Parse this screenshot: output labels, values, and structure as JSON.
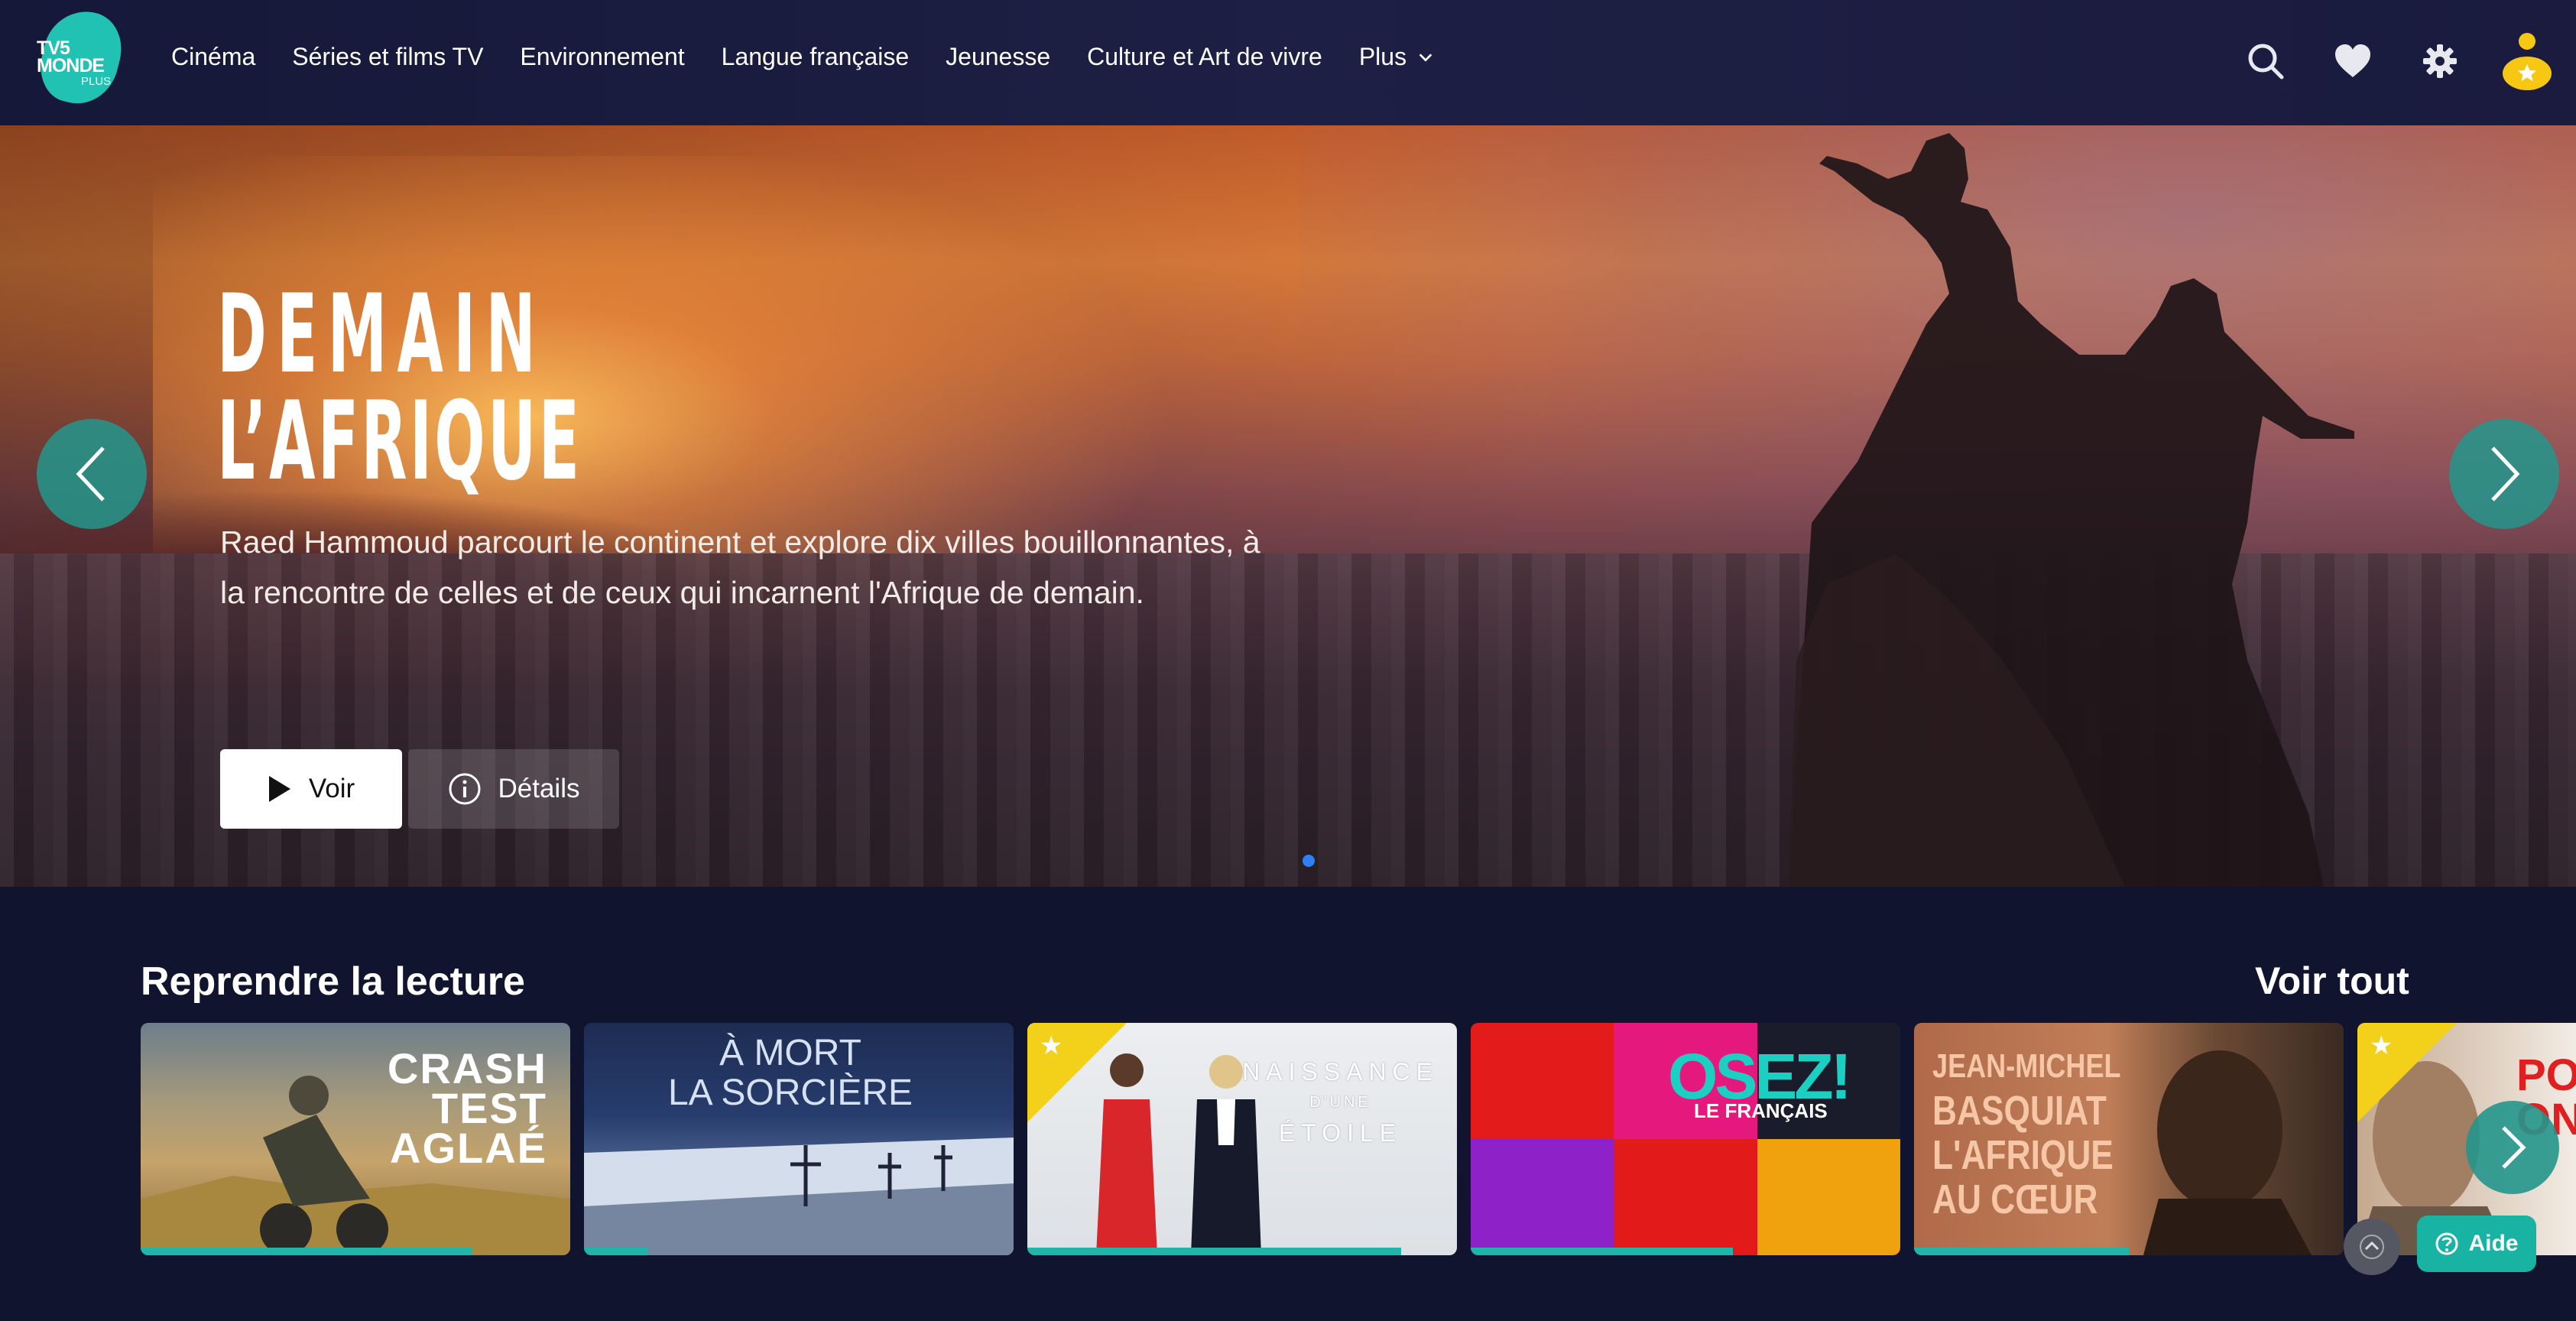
{
  "logo": {
    "text_line1": "TV5",
    "text_line2": "MONDE",
    "text_sub": "PLUS"
  },
  "nav": {
    "items": [
      {
        "label": "Cinéma"
      },
      {
        "label": "Séries et films TV"
      },
      {
        "label": "Environnement"
      },
      {
        "label": "Langue française"
      },
      {
        "label": "Jeunesse"
      },
      {
        "label": "Culture et Art de vivre"
      },
      {
        "label": "Plus"
      }
    ]
  },
  "header_icons": [
    "search-icon",
    "heart-icon",
    "gear-icon",
    "profile-icon"
  ],
  "hero": {
    "title_line1": "DEMAIN",
    "title_line2": "L’AFRIQUE",
    "description": "Raed Hammoud parcourt le continent et explore dix villes bouillonnantes, à la rencontre de celles et de ceux qui incarnent l'Afrique de demain.",
    "play_label": "Voir",
    "details_label": "Détails"
  },
  "resume": {
    "title": "Reprendre la lecture",
    "see_all": "Voir tout",
    "cards": [
      {
        "title": "CRASH TEST AGLAÉ",
        "line1": "CRASH",
        "line2": "TEST",
        "line3": "AGLAÉ",
        "progress": 0.77,
        "premium": false
      },
      {
        "title": "À MORT LA SORCIÈRE",
        "line1": "À MORT",
        "line2": "LA SORCIÈRE",
        "progress": 0.15,
        "premium": false
      },
      {
        "title": "NAISSANCE D'UNE ÉTOILE",
        "line1": "NAISSANCE",
        "line2": "D'UNE",
        "line3": "ÉTOILE",
        "progress": 0.87,
        "premium": true
      },
      {
        "title": "OSEZ! LE FRANÇAIS",
        "line1": "OSEZ!",
        "line2": "LE FRANÇAIS",
        "progress": 0.61,
        "premium": false
      },
      {
        "title": "JEAN-MICHEL BASQUIAT L'AFRIQUE AU CŒUR",
        "line1": "JEAN-MICHEL",
        "line2": "BASQUIAT",
        "line3": "L'AFRIQUE",
        "line4": "AU CŒUR",
        "progress": 0.5,
        "premium": false
      },
      {
        "title": "PO ON",
        "line1": "PO",
        "line2": "ON",
        "progress": 0,
        "premium": true
      }
    ]
  },
  "help": {
    "label": "Aide"
  },
  "colors": {
    "accent": "#1fb5a8",
    "background": "#11142f",
    "premium": "#f3d11a"
  }
}
